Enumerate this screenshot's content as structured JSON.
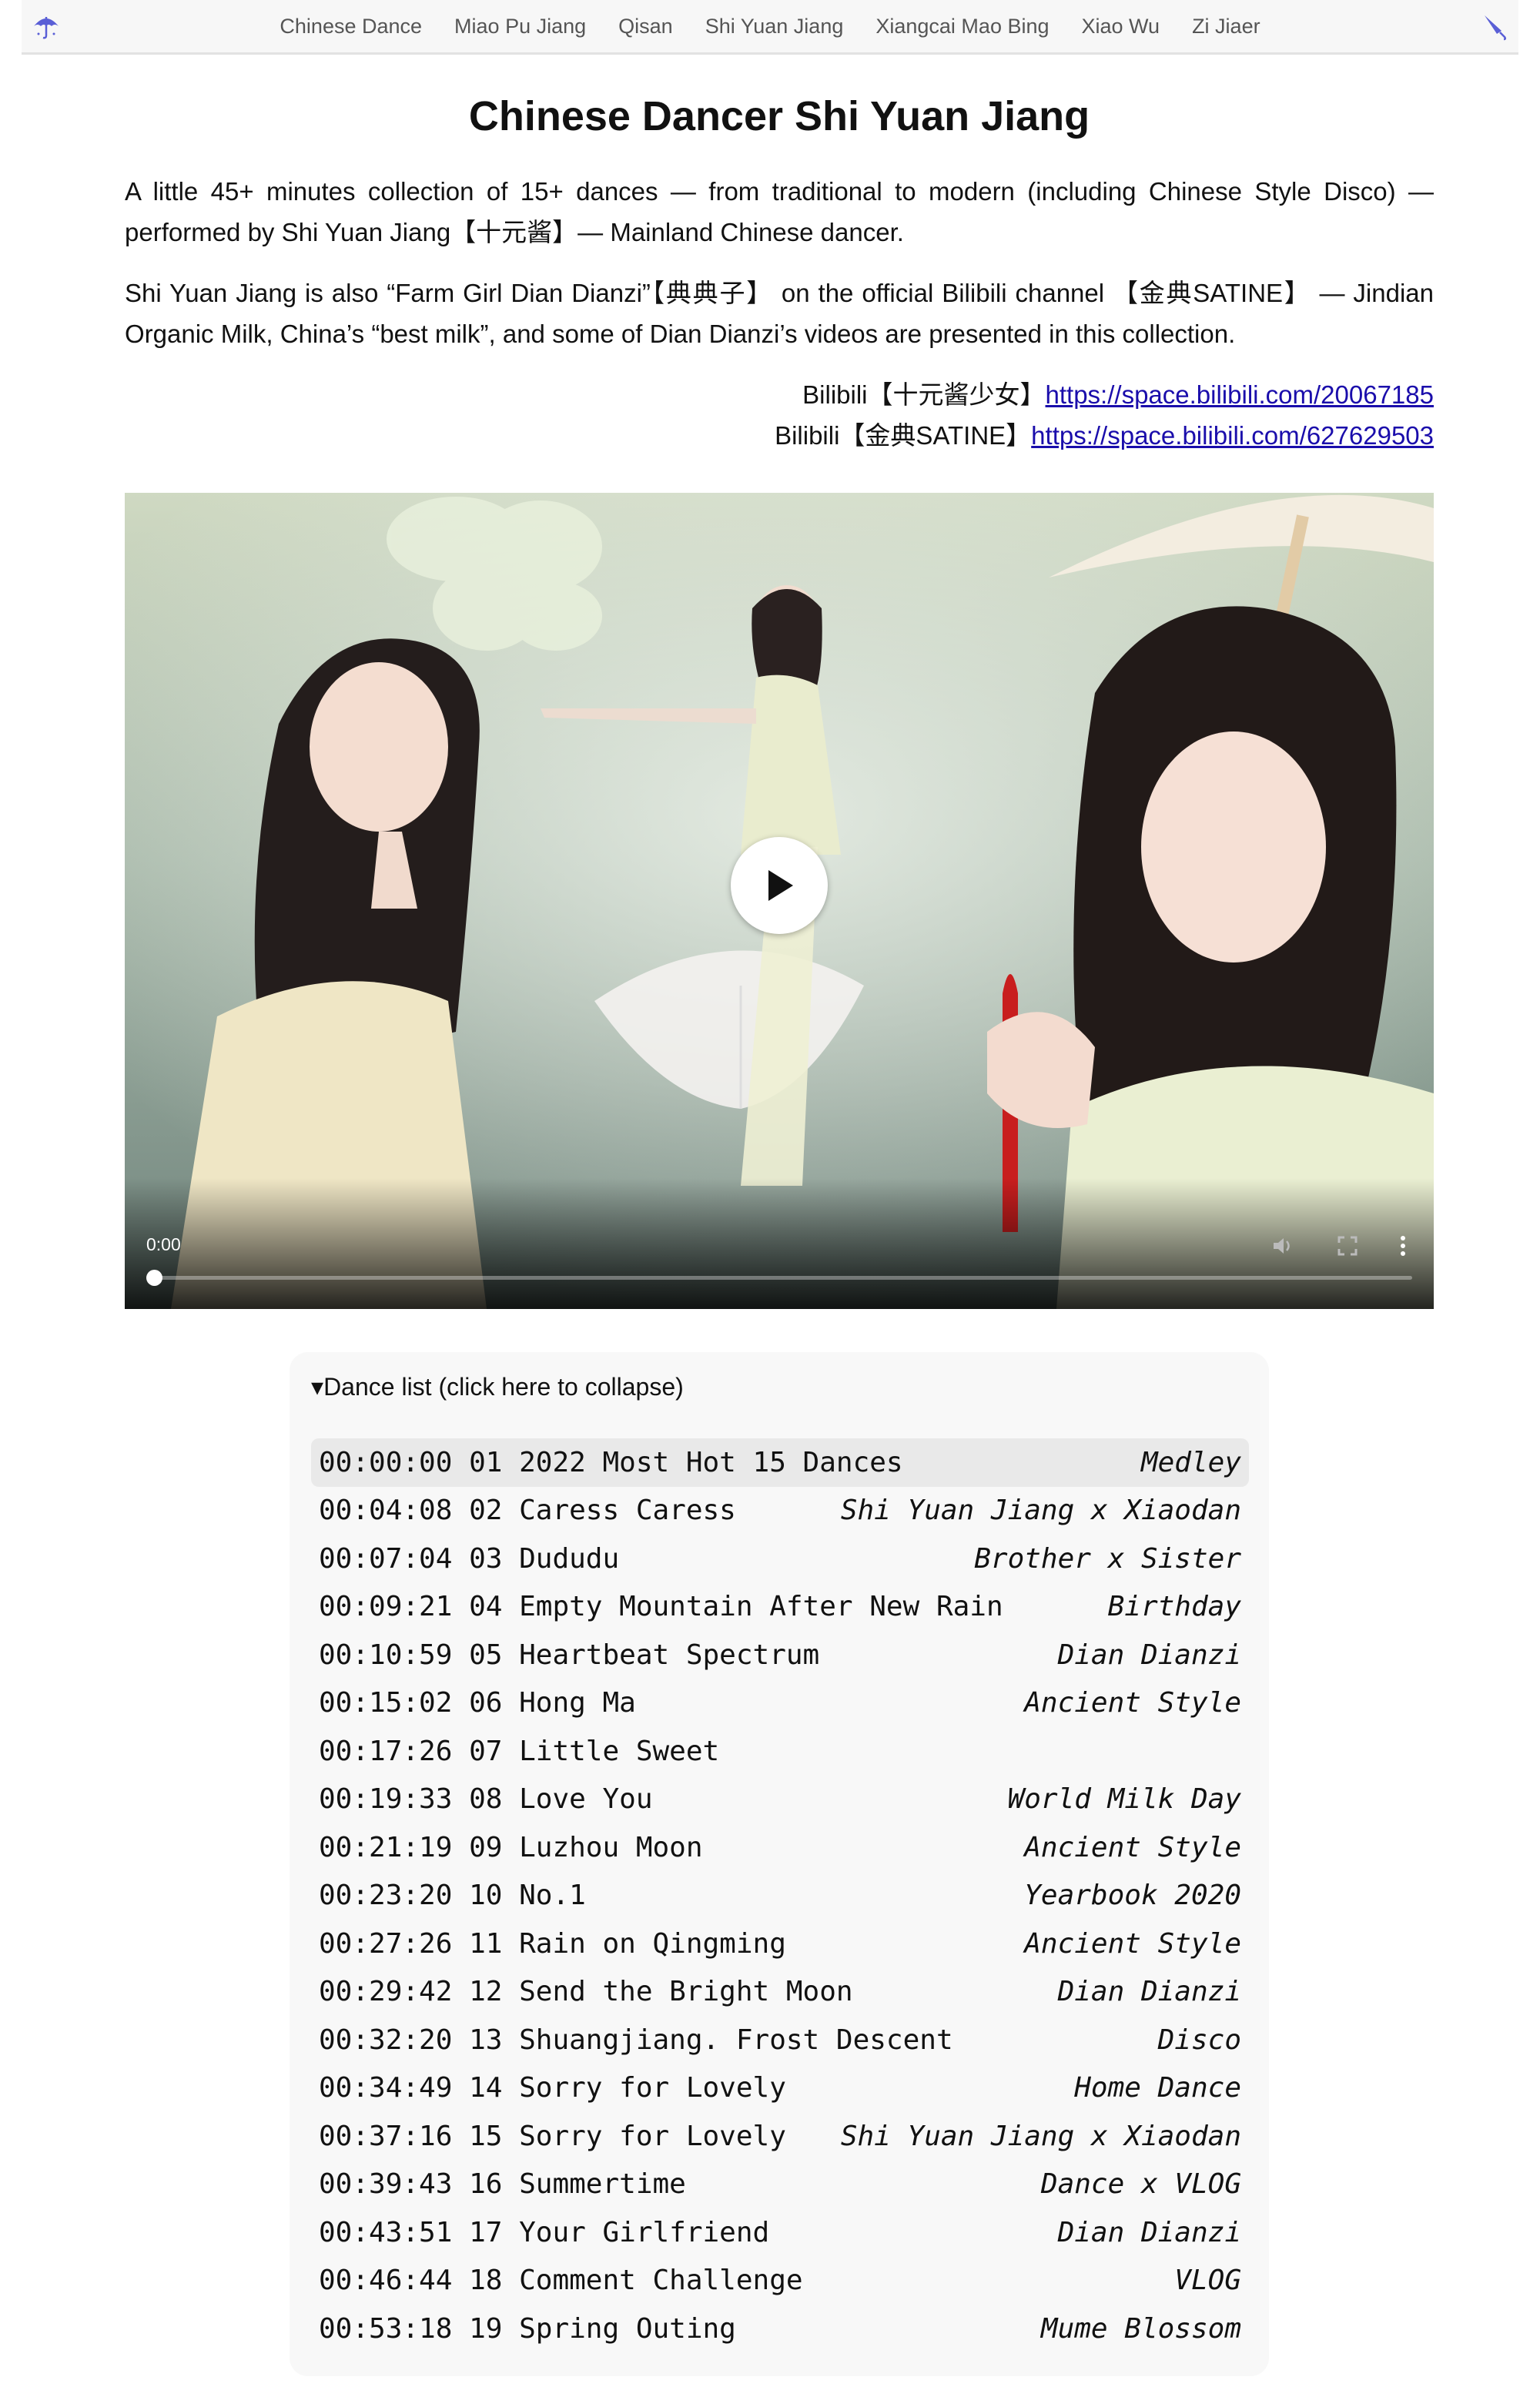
{
  "nav": {
    "items": [
      "Chinese Dance",
      "Miao Pu Jiang",
      "Qisan",
      "Shi Yuan Jiang",
      "Xiangcai Mao Bing",
      "Xiao Wu",
      "Zi Jiaer"
    ],
    "left_icon": "umbrella-icon",
    "right_icon": "closed-umbrella-icon"
  },
  "page": {
    "title": "Chinese Dancer Shi Yuan Jiang",
    "intro1": "A little 45+ minutes collection of 15+ dances — from traditional to modern (including Chinese Style Disco) — performed by Shi Yuan Jiang【十元酱】— Mainland Chinese dancer.",
    "intro2": "Shi Yuan Jiang is also “Farm Girl Dian Dianzi”【典典子】 on the official Bilibili channel 【金典SATINE】 — Jindian Organic Milk, China’s “best milk”, and some of Dian Dianzi’s videos are presented in this collection.",
    "link1_label": "Bilibili【十元酱少女】",
    "link1_url": "https://space.bilibili.com/20067185",
    "link2_label": "Bilibili【金典SATINE】",
    "link2_url": "https://space.bilibili.com/627629503"
  },
  "video": {
    "time": "0:00",
    "progress": 0
  },
  "dance_list": {
    "summary": "▾Dance list (click here to collapse)",
    "rows": [
      {
        "time": "00:00:00",
        "title": "01 2022 Most Hot 15 Dances",
        "tag": "Medley"
      },
      {
        "time": "00:04:08",
        "title": "02 Caress Caress",
        "tag": "Shi Yuan Jiang x Xiaodan"
      },
      {
        "time": "00:07:04",
        "title": "03 Dududu",
        "tag": "Brother x Sister"
      },
      {
        "time": "00:09:21",
        "title": "04 Empty Mountain After New Rain",
        "tag": "Birthday"
      },
      {
        "time": "00:10:59",
        "title": "05 Heartbeat Spectrum",
        "tag": "Dian Dianzi"
      },
      {
        "time": "00:15:02",
        "title": "06 Hong Ma",
        "tag": "Ancient Style"
      },
      {
        "time": "00:17:26",
        "title": "07 Little Sweet",
        "tag": ""
      },
      {
        "time": "00:19:33",
        "title": "08 Love You",
        "tag": "World Milk Day"
      },
      {
        "time": "00:21:19",
        "title": "09 Luzhou Moon",
        "tag": "Ancient Style"
      },
      {
        "time": "00:23:20",
        "title": "10 No.1",
        "tag": "Yearbook 2020"
      },
      {
        "time": "00:27:26",
        "title": "11 Rain on Qingming",
        "tag": "Ancient Style"
      },
      {
        "time": "00:29:42",
        "title": "12 Send the Bright Moon",
        "tag": "Dian Dianzi"
      },
      {
        "time": "00:32:20",
        "title": "13 Shuangjiang. Frost Descent",
        "tag": "Disco"
      },
      {
        "time": "00:34:49",
        "title": "14 Sorry for Lovely",
        "tag": "Home Dance"
      },
      {
        "time": "00:37:16",
        "title": "15 Sorry for Lovely",
        "tag": "Shi Yuan Jiang x Xiaodan"
      },
      {
        "time": "00:39:43",
        "title": "16 Summertime",
        "tag": "Dance x VLOG"
      },
      {
        "time": "00:43:51",
        "title": "17 Your Girlfriend",
        "tag": "Dian Dianzi"
      },
      {
        "time": "00:46:44",
        "title": "18 Comment Challenge",
        "tag": "VLOG"
      },
      {
        "time": "00:53:18",
        "title": "19 Spring Outing",
        "tag": "Mume Blossom"
      }
    ]
  }
}
